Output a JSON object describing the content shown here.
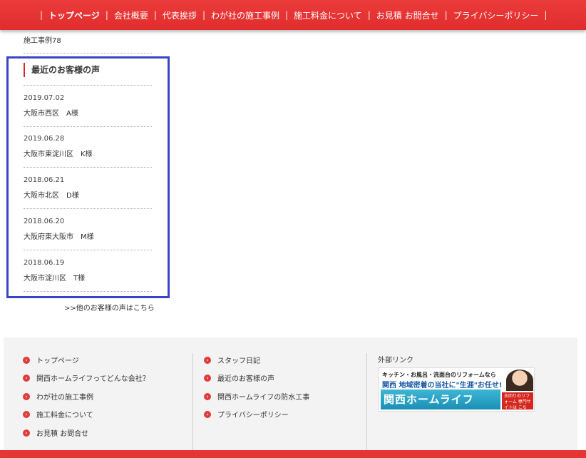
{
  "nav": {
    "items": [
      {
        "label": "トップページ",
        "bold": true
      },
      {
        "label": "会社概要"
      },
      {
        "label": "代表挨拶"
      },
      {
        "label": "わが社の施工事例"
      },
      {
        "label": "施工料金について"
      },
      {
        "label": "お見積 お問合せ"
      },
      {
        "label": "プライバシーポリシー"
      }
    ]
  },
  "sidebar": {
    "prev_item": "施工事例78",
    "voice_title": "最近のお客様の声",
    "voices": [
      {
        "date": "2019.07.02",
        "name": "大阪市西区　A様"
      },
      {
        "date": "2019.06.28",
        "name": "大阪市東淀川区　K様"
      },
      {
        "date": "2018.06.21",
        "name": "大阪市北区　D様"
      },
      {
        "date": "2018.06.20",
        "name": "大阪府東大阪市　M様"
      },
      {
        "date": "2018.06.19",
        "name": "大阪市淀川区　T様"
      }
    ],
    "more_link": ">>他のお客様の声はこちら"
  },
  "footer": {
    "col1": [
      "トップページ",
      "関西ホームライフってどんな会社？",
      "わが社の施工事例",
      "施工料金について",
      "お見積 お問合せ"
    ],
    "col2": [
      "スタッフ日記",
      "最近のお客様の声",
      "関西ホームライフの防水工事",
      "プライバシーポリシー"
    ],
    "external_title": "外部リンク",
    "banner": {
      "top": "キッチン・お風呂・洗面台のリフォームなら",
      "mid": "関西 地域密着の当社に\"生涯\"お任せ!",
      "main": "関西ホームライフ",
      "cta": "水回りのリフォーム 専門サイトは こちら!"
    }
  },
  "colors": {
    "accent": "#e02c2c",
    "highlight": "#3a44c8"
  }
}
